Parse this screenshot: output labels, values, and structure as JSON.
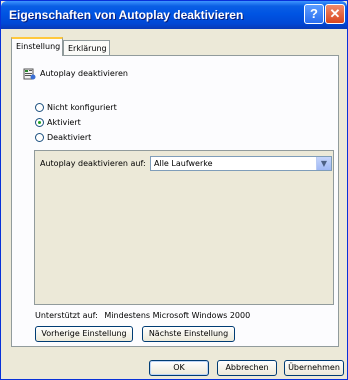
{
  "window": {
    "title": "Eigenschaften von Autoplay deaktivieren"
  },
  "tabs": [
    {
      "label": "Einstellung"
    },
    {
      "label": "Erklärung"
    }
  ],
  "policy": {
    "name": "Autoplay deaktivieren",
    "icon": "policy-setting-icon"
  },
  "radios": [
    {
      "label": "Nicht konfiguriert",
      "selected": false
    },
    {
      "label": "Aktiviert",
      "selected": true
    },
    {
      "label": "Deaktiviert",
      "selected": false
    }
  ],
  "option": {
    "label": "Autoplay deaktivieren auf:",
    "value": "Alle Laufwerke"
  },
  "supported": {
    "label": "Unterstützt auf:",
    "value": "Mindestens Microsoft Windows 2000"
  },
  "nav": {
    "prev": "Vorherige Einstellung",
    "next": "Nächste Einstellung"
  },
  "buttons": {
    "ok": "OK",
    "cancel": "Abbrechen",
    "apply": "Übernehmen"
  },
  "colors": {
    "titlebar": "#0054e3",
    "dialog": "#ece9d8",
    "selected_radio": "#21a121"
  }
}
